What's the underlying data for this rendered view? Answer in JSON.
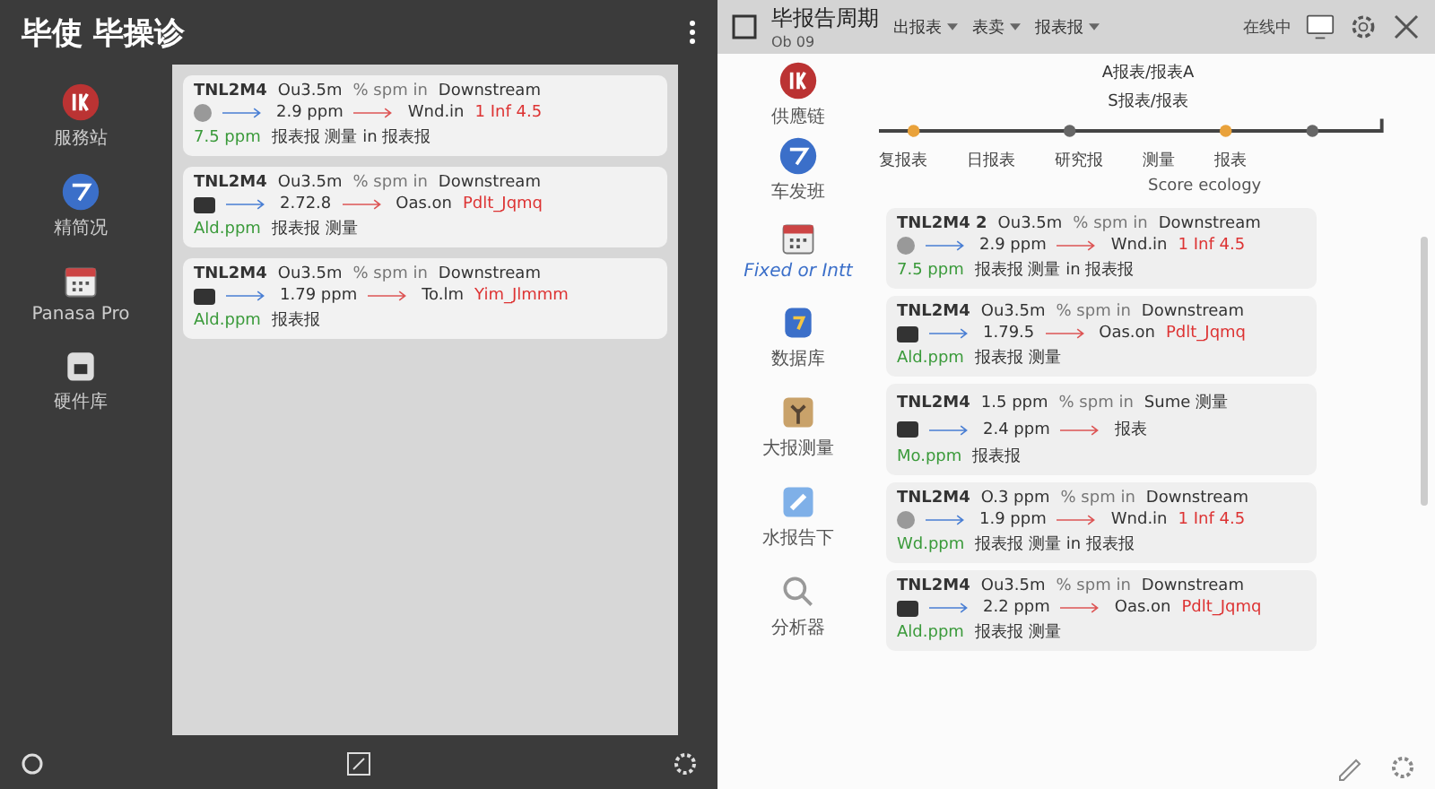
{
  "left_panel": {
    "title": "毕使 毕操诊",
    "sidebar": [
      {
        "label": "服務站"
      },
      {
        "label": "精简况"
      },
      {
        "label": "Panasa Pro"
      },
      {
        "label": "硬件库"
      }
    ],
    "cards": [
      {
        "kind": "sensor",
        "code": "TNL2M4",
        "source": "Ou3.5m",
        "tag": "% spm in",
        "target": "Downstream",
        "qty": "2.9 ppm",
        "out": "Wnd.in",
        "alert": "1 Inf 4.5",
        "rate": "7.5 ppm",
        "note": "报表报 测量 in 报表报"
      },
      {
        "kind": "device",
        "code": "TNL2M4",
        "source": "Ou3.5m",
        "tag": "% spm in",
        "target": "Downstream",
        "qty": "2.72.8",
        "out": "Oas.on",
        "alert": "Pdlt_Jqmq",
        "rate": "Ald.ppm",
        "note": "报表报 测量"
      },
      {
        "kind": "device",
        "code": "TNL2M4",
        "source": "Ou3.5m",
        "tag": "% spm in",
        "target": "Downstream",
        "qty": "1.79 ppm",
        "out": "To.lm",
        "alert": "Yim_Jlmmm",
        "rate": "Ald.ppm",
        "note": "报表报"
      }
    ]
  },
  "right_panel": {
    "title": "毕报告周期",
    "subtitle": "Ob 09",
    "menus": [
      {
        "label": "出报表"
      },
      {
        "label": "表卖"
      },
      {
        "label": "报表报"
      }
    ],
    "status": "在线中",
    "diagram": {
      "sources": [
        {
          "label": "供應链"
        },
        {
          "label": "车发班"
        }
      ],
      "device_label": "复报表",
      "stops": [
        {
          "label": "日报表"
        },
        {
          "label": "研究报"
        },
        {
          "label": "测量"
        },
        {
          "label": "报表"
        }
      ],
      "caption": "Score ecology",
      "notes": [
        "A报表/报表A",
        "S报表/报表"
      ]
    },
    "sidebar": [
      {
        "label": "Fixed or Intt"
      },
      {
        "label": "数据库"
      },
      {
        "label": "大报测量"
      },
      {
        "label": "水报告下"
      },
      {
        "label": "分析器"
      }
    ],
    "cards": [
      {
        "kind": "sensor",
        "code": "TNL2M4 2",
        "source": "Ou3.5m",
        "tag": "% spm in",
        "target": "Downstream",
        "qty": "2.9 ppm",
        "out": "Wnd.in",
        "alert": "1 Inf 4.5",
        "rate": "7.5 ppm",
        "note": "报表报 测量 in 报表报"
      },
      {
        "kind": "device",
        "code": "TNL2M4",
        "source": "Ou3.5m",
        "tag": "% spm in",
        "target": "Downstream",
        "qty": "1.79.5",
        "out": "Oas.on",
        "alert": "Pdlt_Jqmq",
        "rate": "Ald.ppm",
        "note": "报表报 测量"
      },
      {
        "kind": "device",
        "code": "TNL2M4",
        "source": "1.5 ppm",
        "tag": "% spm in",
        "target": "Sume 测量",
        "qty": "2.4 ppm",
        "out": "报表",
        "rate": "Mo.ppm",
        "note": "报表报"
      },
      {
        "kind": "sensor",
        "code": "TNL2M4",
        "source": "O.3 ppm",
        "tag": "% spm in",
        "target": "Downstream",
        "qty": "1.9 ppm",
        "out": "Wnd.in",
        "alert": "1 Inf 4.5",
        "rate": "Wd.ppm",
        "note": "报表报 测量 in 报表报"
      },
      {
        "kind": "device",
        "code": "TNL2M4",
        "source": "Ou3.5m",
        "tag": "% spm in",
        "target": "Downstream",
        "qty": "2.2 ppm",
        "out": "Oas.on",
        "alert": "Pdlt_Jqmq",
        "rate": "Ald.ppm",
        "note": "报表报 测量"
      }
    ]
  }
}
